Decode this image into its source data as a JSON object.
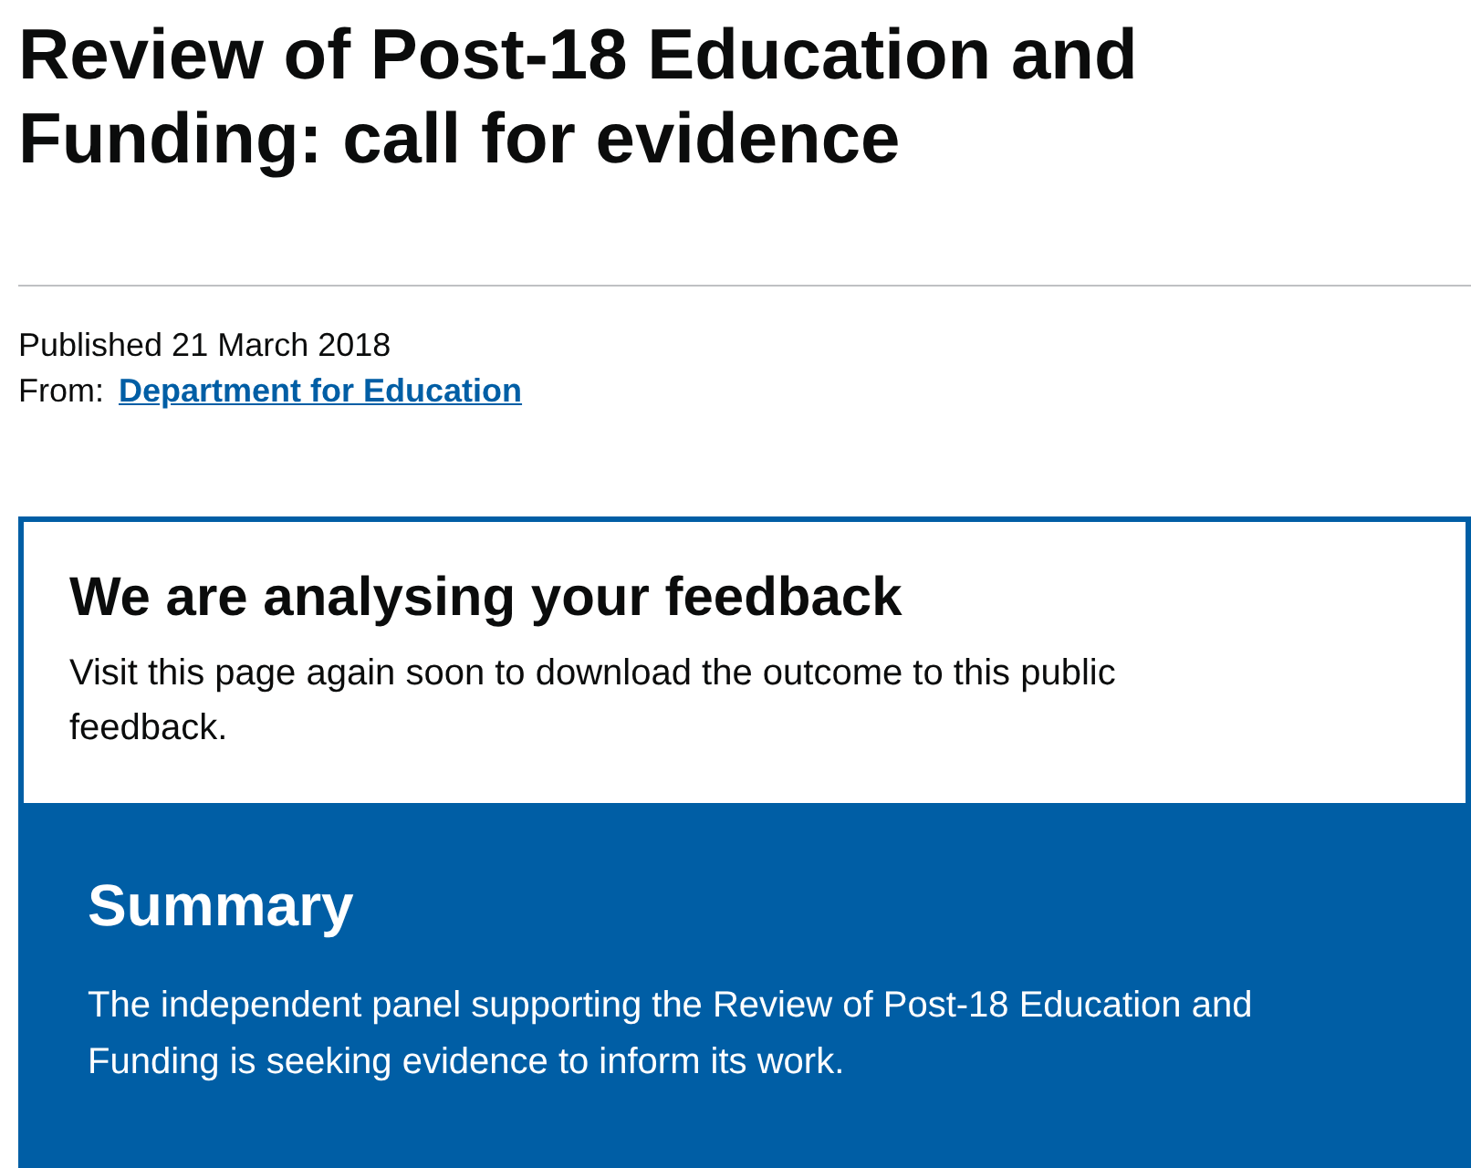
{
  "title": "Review of Post-18 Education and Funding: call for evidence",
  "published": {
    "label": "Published",
    "date": "21 March 2018"
  },
  "from": {
    "label": "From:",
    "link": "Department for Education"
  },
  "notice": {
    "heading": "We are analysing your feedback",
    "text": "Visit this page again soon to download the outcome to this public feedback."
  },
  "summary": {
    "heading": "Summary",
    "text": "The independent panel supporting the Review of Post-18 Education and Funding is seeking evidence to inform its work."
  }
}
